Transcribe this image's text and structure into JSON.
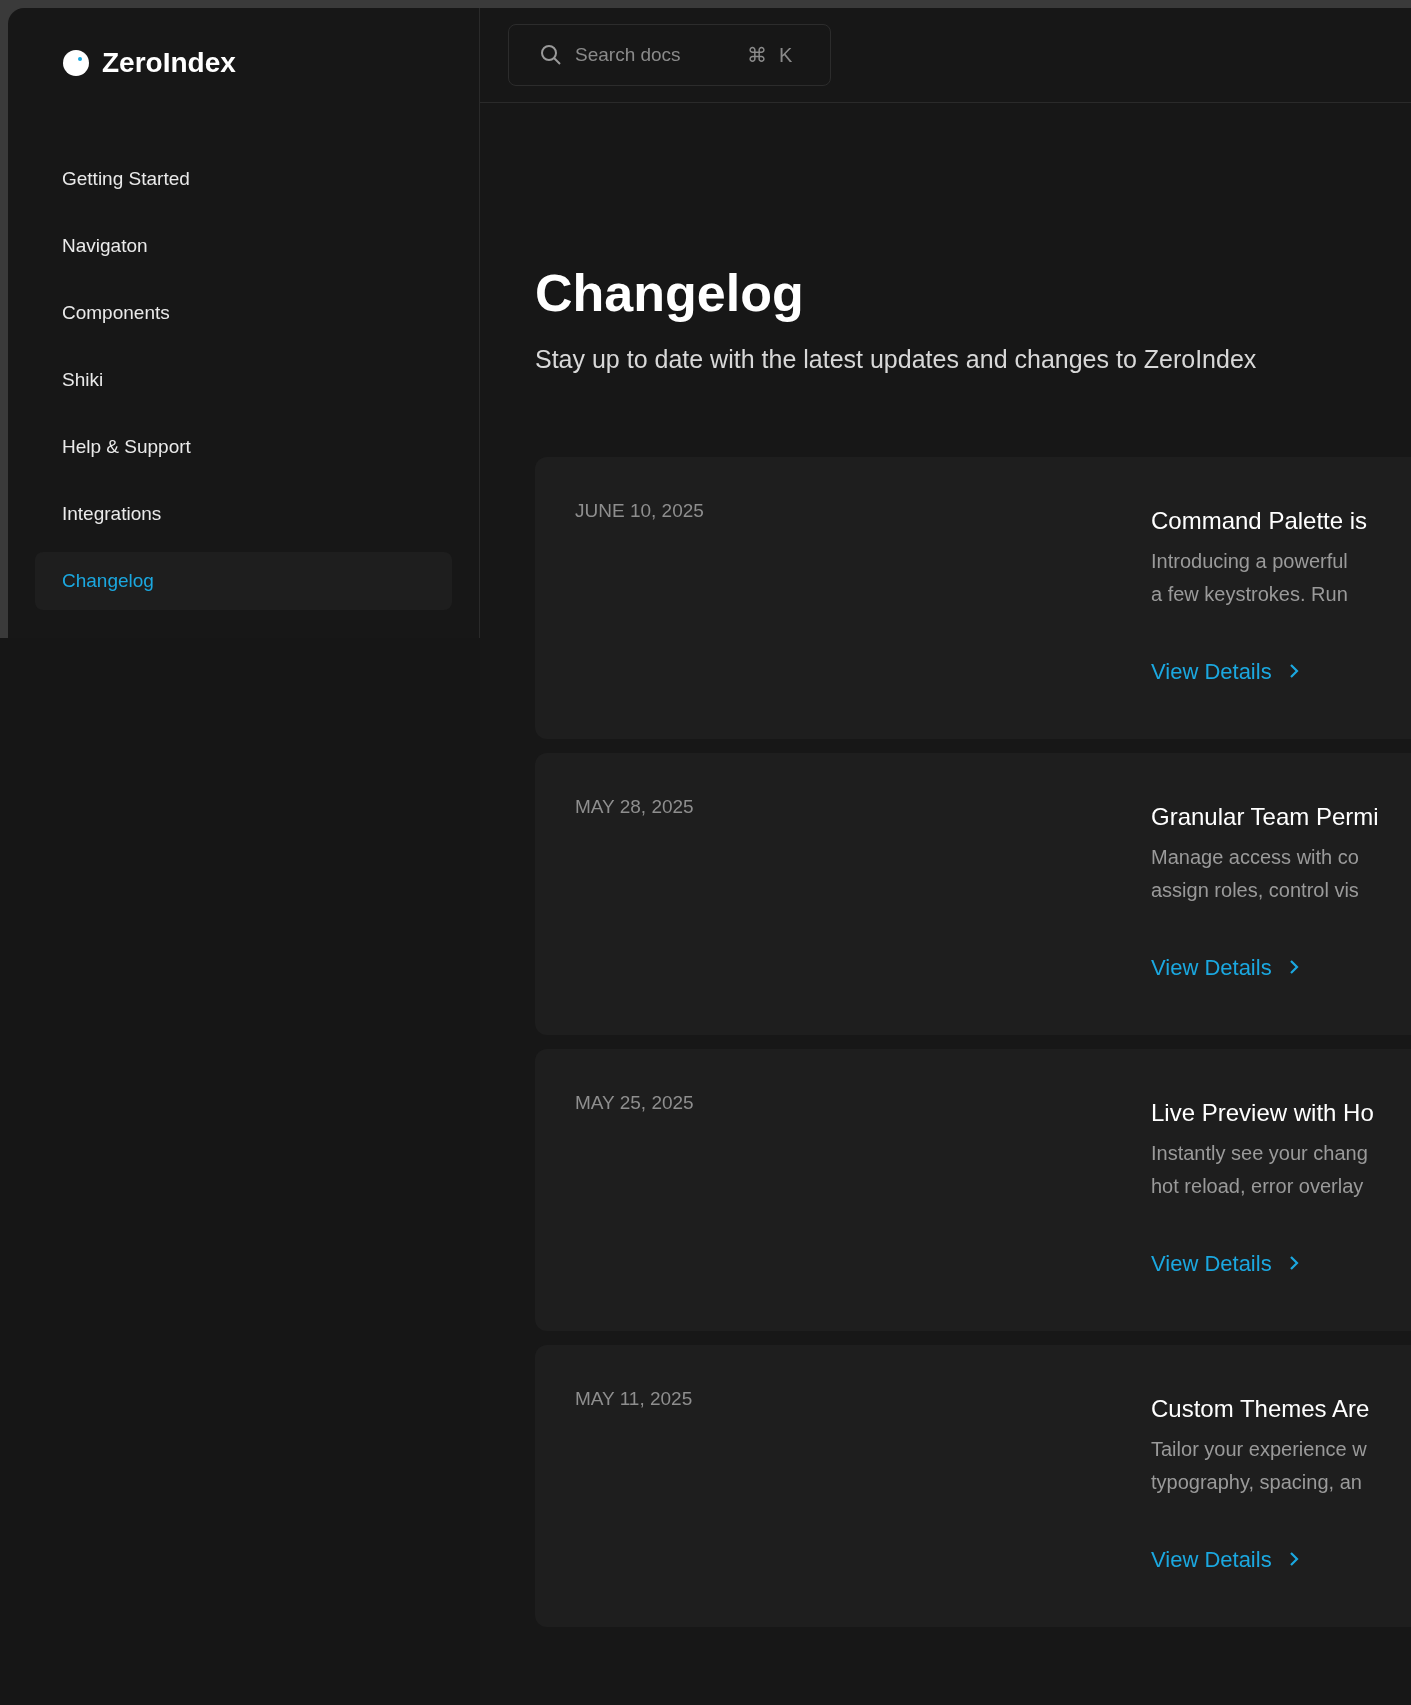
{
  "brand": {
    "name": "ZeroIndex"
  },
  "sidebar": {
    "items": [
      {
        "label": "Getting Started",
        "selected": false
      },
      {
        "label": "Navigaton",
        "selected": false
      },
      {
        "label": "Components",
        "selected": false
      },
      {
        "label": "Shiki",
        "selected": false
      },
      {
        "label": "Help & Support",
        "selected": false
      },
      {
        "label": "Integrations",
        "selected": false
      },
      {
        "label": "Changelog",
        "selected": true
      }
    ]
  },
  "search": {
    "placeholder": "Search docs",
    "shortcut": [
      "⌘",
      "K"
    ]
  },
  "page": {
    "title": "Changelog",
    "subtitle": "Stay up to date with the latest updates and changes to ZeroIndex"
  },
  "entries": [
    {
      "date": "JUNE 10, 2025",
      "title": "Command Palette is",
      "description": [
        "Introducing a powerful",
        "a few keystrokes. Run"
      ],
      "link": "View Details"
    },
    {
      "date": "MAY 28, 2025",
      "title": "Granular Team Permi",
      "description": [
        "Manage access with co",
        "assign roles, control vis"
      ],
      "link": "View Details"
    },
    {
      "date": "MAY 25, 2025",
      "title": "Live Preview with Ho",
      "description": [
        "Instantly see your chang",
        "hot reload, error overlay"
      ],
      "link": "View Details"
    },
    {
      "date": "MAY 11, 2025",
      "title": "Custom Themes Are",
      "description": [
        "Tailor your experience w",
        "typography, spacing, an"
      ],
      "link": "View Details"
    }
  ]
}
